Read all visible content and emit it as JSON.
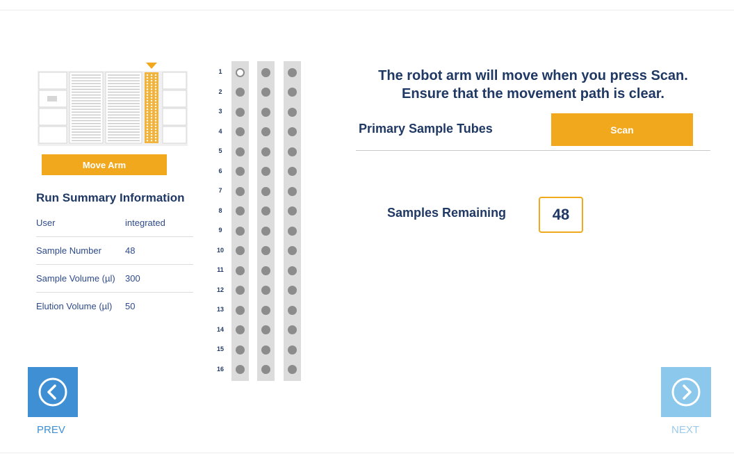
{
  "deck": {
    "arm_position": "column-6",
    "highlight_color": "#f2a81d"
  },
  "move_arm": {
    "label": "Move Arm"
  },
  "summary": {
    "title": "Run Summary Information",
    "rows": [
      {
        "key": "User",
        "value": "integrated"
      },
      {
        "key": "Sample Number",
        "value": "48"
      },
      {
        "key": "Sample Volume (µl)",
        "value": "300"
      },
      {
        "key": "Elution Volume (µl)",
        "value": "50"
      }
    ]
  },
  "rack": {
    "columns": 3,
    "rows": [
      "1",
      "2",
      "3",
      "4",
      "5",
      "6",
      "7",
      "8",
      "9",
      "10",
      "11",
      "12",
      "13",
      "14",
      "15",
      "16"
    ],
    "current_well": {
      "column": 1,
      "row": 1
    }
  },
  "instruction": {
    "line1": "The robot arm will move when you press Scan.",
    "line2": "Ensure that the movement path is clear."
  },
  "scan_section": {
    "label": "Primary Sample Tubes",
    "button": "Scan"
  },
  "samples_remaining": {
    "label": "Samples Remaining",
    "value": "48"
  },
  "nav": {
    "prev": "PREV",
    "next": "NEXT"
  },
  "colors": {
    "accent": "#f2a81d",
    "primary_text": "#1f3864",
    "nav_blue": "#3e8fd4",
    "nav_disabled": "#8cc7ec"
  }
}
